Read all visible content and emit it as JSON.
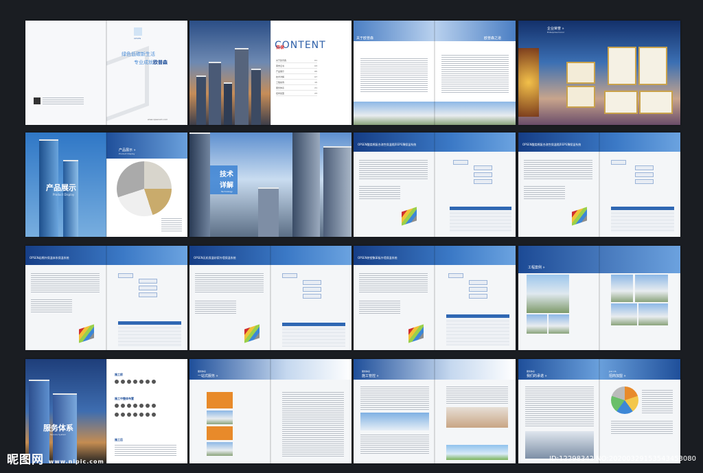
{
  "spread1": {
    "tagline1": "绿色低碳新生活",
    "tagline2a": "专业成就",
    "tagline2b": "欧普森",
    "logo": "OPSEN",
    "website": "www.opsenem.com"
  },
  "spread2": {
    "heading_cn": "目录",
    "heading_en": "CONTENT",
    "toc": [
      {
        "label": "关于欧普森",
        "page": "01"
      },
      {
        "label": "荣誉证书",
        "page": "03"
      },
      {
        "label": "产品展示",
        "page": "05"
      },
      {
        "label": "技术详解",
        "page": "07"
      },
      {
        "label": "工程案例",
        "page": "15"
      },
      {
        "label": "服务体系",
        "page": "21"
      },
      {
        "label": "招商加盟",
        "page": "23"
      }
    ]
  },
  "spread3": {
    "left_title": "关于欧普森",
    "right_title": "欧普森之道"
  },
  "spread4": {
    "title": "企业荣誉 »",
    "subtitle": "Enterprise honor"
  },
  "spread5": {
    "left_title": "产品展示",
    "left_sub": "Product Display",
    "right_title": "产品展示 »",
    "right_sub": "Product Display"
  },
  "spread6": {
    "title_l1": "技术",
    "title_l2": "详解",
    "sub": "Technology"
  },
  "spread7": {
    "band": "OPSEN酸类棉复合改性保温隔声EPS薄保温系统"
  },
  "spread8": {
    "band": "OPSEN酸类棉复合改性保温隔声EPS薄保温系统"
  },
  "spread9": {
    "band": "OPSEN岩棉外保温体系保温系统"
  },
  "spread10": {
    "band": "OPSEN无机保温砂浆外墙保温系统"
  },
  "spread11": {
    "band": "OPSEN挤塑聚苯板外墙保温系统"
  },
  "spread12": {
    "title": "工程案例 »"
  },
  "spread13": {
    "title": "服务体系",
    "sub": "Service System",
    "items": [
      "施工前",
      "施工中整体布置",
      "施工后"
    ]
  },
  "spread14": {
    "title_top": "服务体系",
    "title": "一站式服务 »"
  },
  "spread15": {
    "title_top": "服务体系",
    "title": "施工管控 »"
  },
  "spread16": {
    "title_top": "服务体系",
    "title": "我们的承诺 »",
    "right_title": "招商加盟 »",
    "right_top": "Join US"
  },
  "watermark": {
    "brand": "昵图网",
    "site": "www.nipic.com",
    "id": "ID:12298342 NO:20200329153543453080"
  }
}
